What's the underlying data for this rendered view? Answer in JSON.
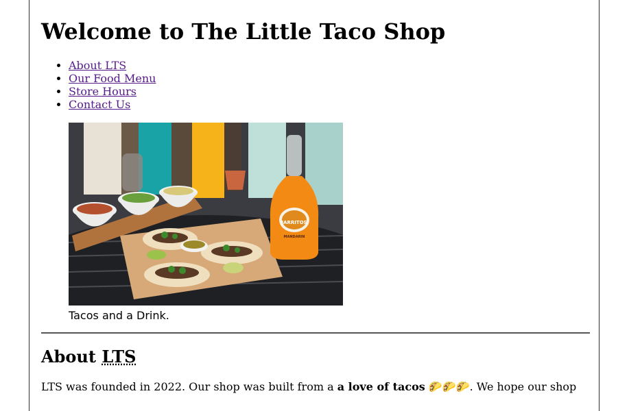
{
  "header": {
    "title": "Welcome to The Little Taco Shop"
  },
  "nav": {
    "items": [
      {
        "label": "About LTS"
      },
      {
        "label": "Our Food Menu"
      },
      {
        "label": "Store Hours"
      },
      {
        "label": "Contact Us"
      }
    ]
  },
  "figure": {
    "caption": "Tacos and a Drink.",
    "bottle_label": "JARRITOS",
    "bottle_flavor": "MANDARIN"
  },
  "about": {
    "heading_prefix": "About ",
    "heading_abbr": "LTS",
    "text_before": "LTS was founded in 2022. Our shop was built from a ",
    "bold_text": "a love of tacos",
    "emoji": "🌮🌮🌮",
    "text_after": ". We hope our shop"
  },
  "colors": {
    "link": "#551a8b",
    "rule": "#555555"
  }
}
